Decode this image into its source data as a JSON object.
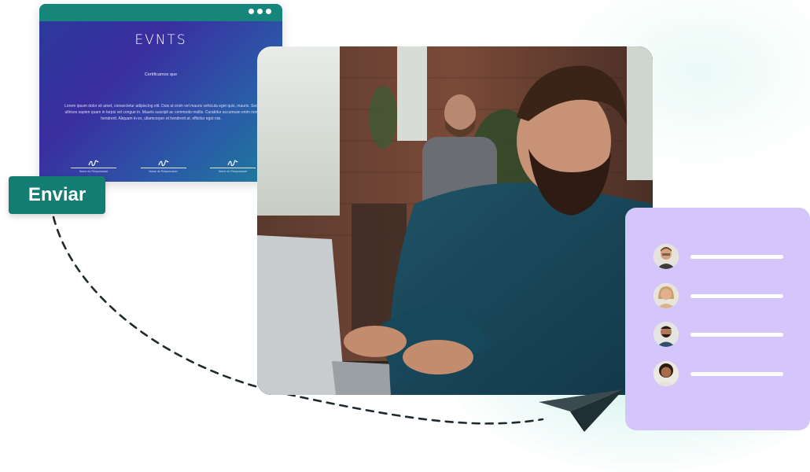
{
  "certificate": {
    "logo": "EVNTS",
    "subtitle": "Certificamos que",
    "body": "Lorem ipsum dolor sit amet, consectetur adipiscing elit. Duis ut enim vel mauris vehicula eget quis, mauris. Sed ultrices sapien quam in turpis vel congue in. Mauris suscipit ac commodo mollis. Curabitur accumsan enim non hendrerit. Aliquam in ex, ullamcorper et hendrerit at, efficitur eget nisi.",
    "signatories": [
      "Nome do Responsável",
      "Nome do Responsável",
      "Nome do Responsável"
    ],
    "window_dots": 3
  },
  "send_button": {
    "label": "Enviar"
  },
  "recipients": {
    "count": 4,
    "items": [
      {
        "avatar": "person-avatar-1"
      },
      {
        "avatar": "person-avatar-2"
      },
      {
        "avatar": "person-avatar-3"
      },
      {
        "avatar": "person-avatar-4"
      }
    ]
  },
  "colors": {
    "accent_teal": "#137d74",
    "recipients_card": "#d4c6fb",
    "certificate_gradient_start": "#2a3a9a",
    "certificate_gradient_end": "#1c7f9a",
    "plane": "#1f2f33"
  },
  "icons": [
    "paper-plane-icon",
    "window-dots-icon",
    "signature-icon"
  ]
}
